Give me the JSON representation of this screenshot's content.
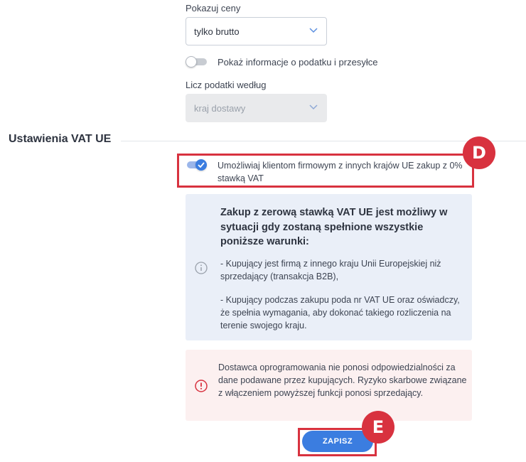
{
  "prices": {
    "label": "Pokazuj ceny",
    "selected": "tylko brutto"
  },
  "tax_info_toggle": {
    "label": "Pokaż informacje o podatku i przesyłce",
    "enabled": false
  },
  "tax_calc": {
    "label": "Licz podatki według",
    "selected": "kraj dostawy",
    "disabled": true
  },
  "vat_section": {
    "title": "Ustawienia VAT UE",
    "toggle_label": "Umożliwiaj klientom firmowym z innych krajów UE zakup z 0% stawką VAT",
    "toggle_enabled": true
  },
  "info_box": {
    "title": "Zakup z zerową stawką VAT UE jest możliwy w sytuacji gdy zostaną spełnione wszystkie poniższe warunki:",
    "condition_1": "- Kupujący jest firmą z innego kraju Unii Europejskiej niż sprzedający (transakcja B2B),",
    "condition_2": "- Kupujący podczas zakupu poda nr VAT UE oraz oświadczy, że spełnia wymagania, aby dokonać takiego rozliczenia na terenie swojego kraju.",
    "icon": "info-icon"
  },
  "warning_box": {
    "text": "Dostawca oprogramowania nie ponosi odpowiedzialności za dane podawane przez kupujących. Ryzyko skarbowe związane z włączeniem powyższej funkcji ponosi sprzedający.",
    "icon": "alert-icon"
  },
  "save_button": {
    "label": "ZAPISZ"
  },
  "annotations": {
    "marker_d": "D",
    "marker_e": "E"
  },
  "colors": {
    "accent": "#3b7de0",
    "highlight": "#d8323f",
    "info_bg": "#eaeff8",
    "warning_bg": "#fcf0f0"
  }
}
